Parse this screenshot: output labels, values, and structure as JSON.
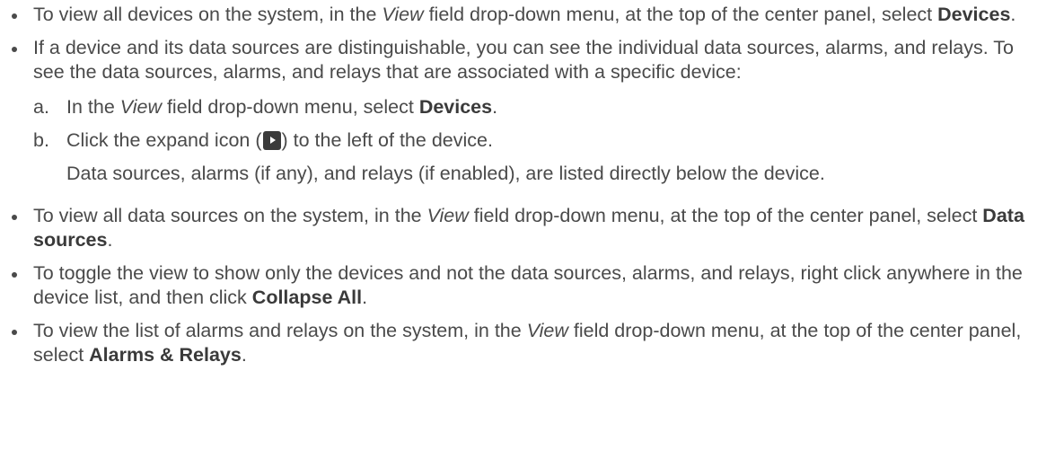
{
  "bullets": [
    {
      "pre": "To view all devices on the system, in the ",
      "field": "View",
      "mid": " field drop-down menu, at the top of the center panel, select ",
      "selection": "Devices",
      "post": "."
    },
    {
      "text": "If a device and its data sources are distinguishable, you can see the individual data sources, alarms, and relays. To see the data sources, alarms, and relays that are associated with a specific device:",
      "steps": [
        {
          "marker": "a.",
          "pre": "In the ",
          "field": "View",
          "mid": " field drop-down menu, select ",
          "selection": "Devices",
          "post": "."
        },
        {
          "marker": "b.",
          "pre": "Click the expand icon (",
          "icon": "expand-icon",
          "post": ") to the left of the device.",
          "note": "Data sources, alarms (if any), and relays (if enabled), are listed directly below the device."
        }
      ]
    },
    {
      "pre": "To view all data sources on the system, in the ",
      "field": "View",
      "mid": " field drop-down menu, at the top of the center panel, select ",
      "selection": "Data sources",
      "post": "."
    },
    {
      "pre": "To toggle the view to show only the devices and not the data sources, alarms, and relays, right click anywhere in the device list, and then click ",
      "selection": "Collapse All",
      "post": "."
    },
    {
      "pre": "To view the list of alarms and relays on the system, in the ",
      "field": "View",
      "mid": " field drop-down menu, at the top of the center panel, select ",
      "selection": "Alarms & Relays",
      "post": "."
    }
  ]
}
